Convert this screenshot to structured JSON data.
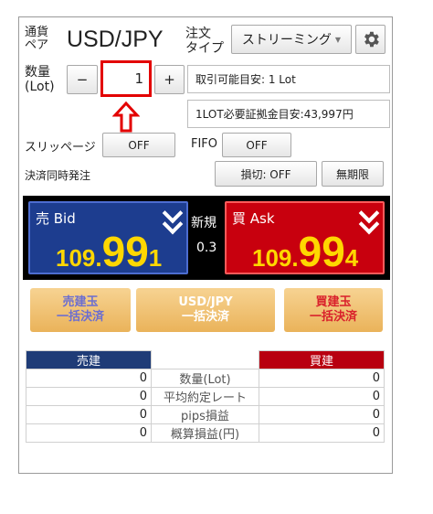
{
  "header": {
    "currency_label": "通貨\nペア",
    "pair": "USD/JPY",
    "order_type_label": "注文\nタイプ",
    "order_type_value": "ストリーミング",
    "order_type_arrow": "▼"
  },
  "quantity": {
    "label": "数量\n(Lot)",
    "minus": "−",
    "value": "1",
    "plus": "+"
  },
  "info": {
    "tradable": "取引可能目安: 1 Lot",
    "margin": "1LOT必要証拠金目安:43,997円"
  },
  "slippage": {
    "label": "スリッページ",
    "value": "OFF"
  },
  "fifo": {
    "label": "FIFO",
    "value": "OFF"
  },
  "simultaneous": {
    "label": "決済同時発注",
    "stop_loss": "損切: OFF",
    "expiry": "無期限"
  },
  "sell": {
    "label": "売 Bid",
    "price_prefix": "109.",
    "price_big": "99",
    "price_small": "1"
  },
  "spread": {
    "label": "新規",
    "value": "0.3"
  },
  "buy": {
    "label": "買 Ask",
    "price_prefix": "109.",
    "price_big": "99",
    "price_small": "4"
  },
  "bulk": {
    "sell": {
      "line1": "売建玉",
      "line2": "一括決済"
    },
    "pair": {
      "line1": "USD/JPY",
      "line2": "一括決済"
    },
    "buy": {
      "line1": "買建玉",
      "line2": "一括決済"
    }
  },
  "positions": {
    "sell_header": "売建",
    "buy_header": "買建",
    "rows": [
      {
        "label": "数量(Lot)",
        "sell": "0",
        "buy": "0"
      },
      {
        "label": "平均約定レート",
        "sell": "0",
        "buy": "0"
      },
      {
        "label": "pips損益",
        "sell": "0",
        "buy": "0"
      },
      {
        "label": "概算損益(円)",
        "sell": "0",
        "buy": "0"
      }
    ]
  },
  "colors": {
    "sell_panel": "#1d3d8f",
    "buy_panel": "#c8000e",
    "highlight": "#e30000",
    "price_digits": "#ffd700"
  },
  "icons": {
    "settings": "gear-icon",
    "arrow": "up-arrow-icon"
  }
}
